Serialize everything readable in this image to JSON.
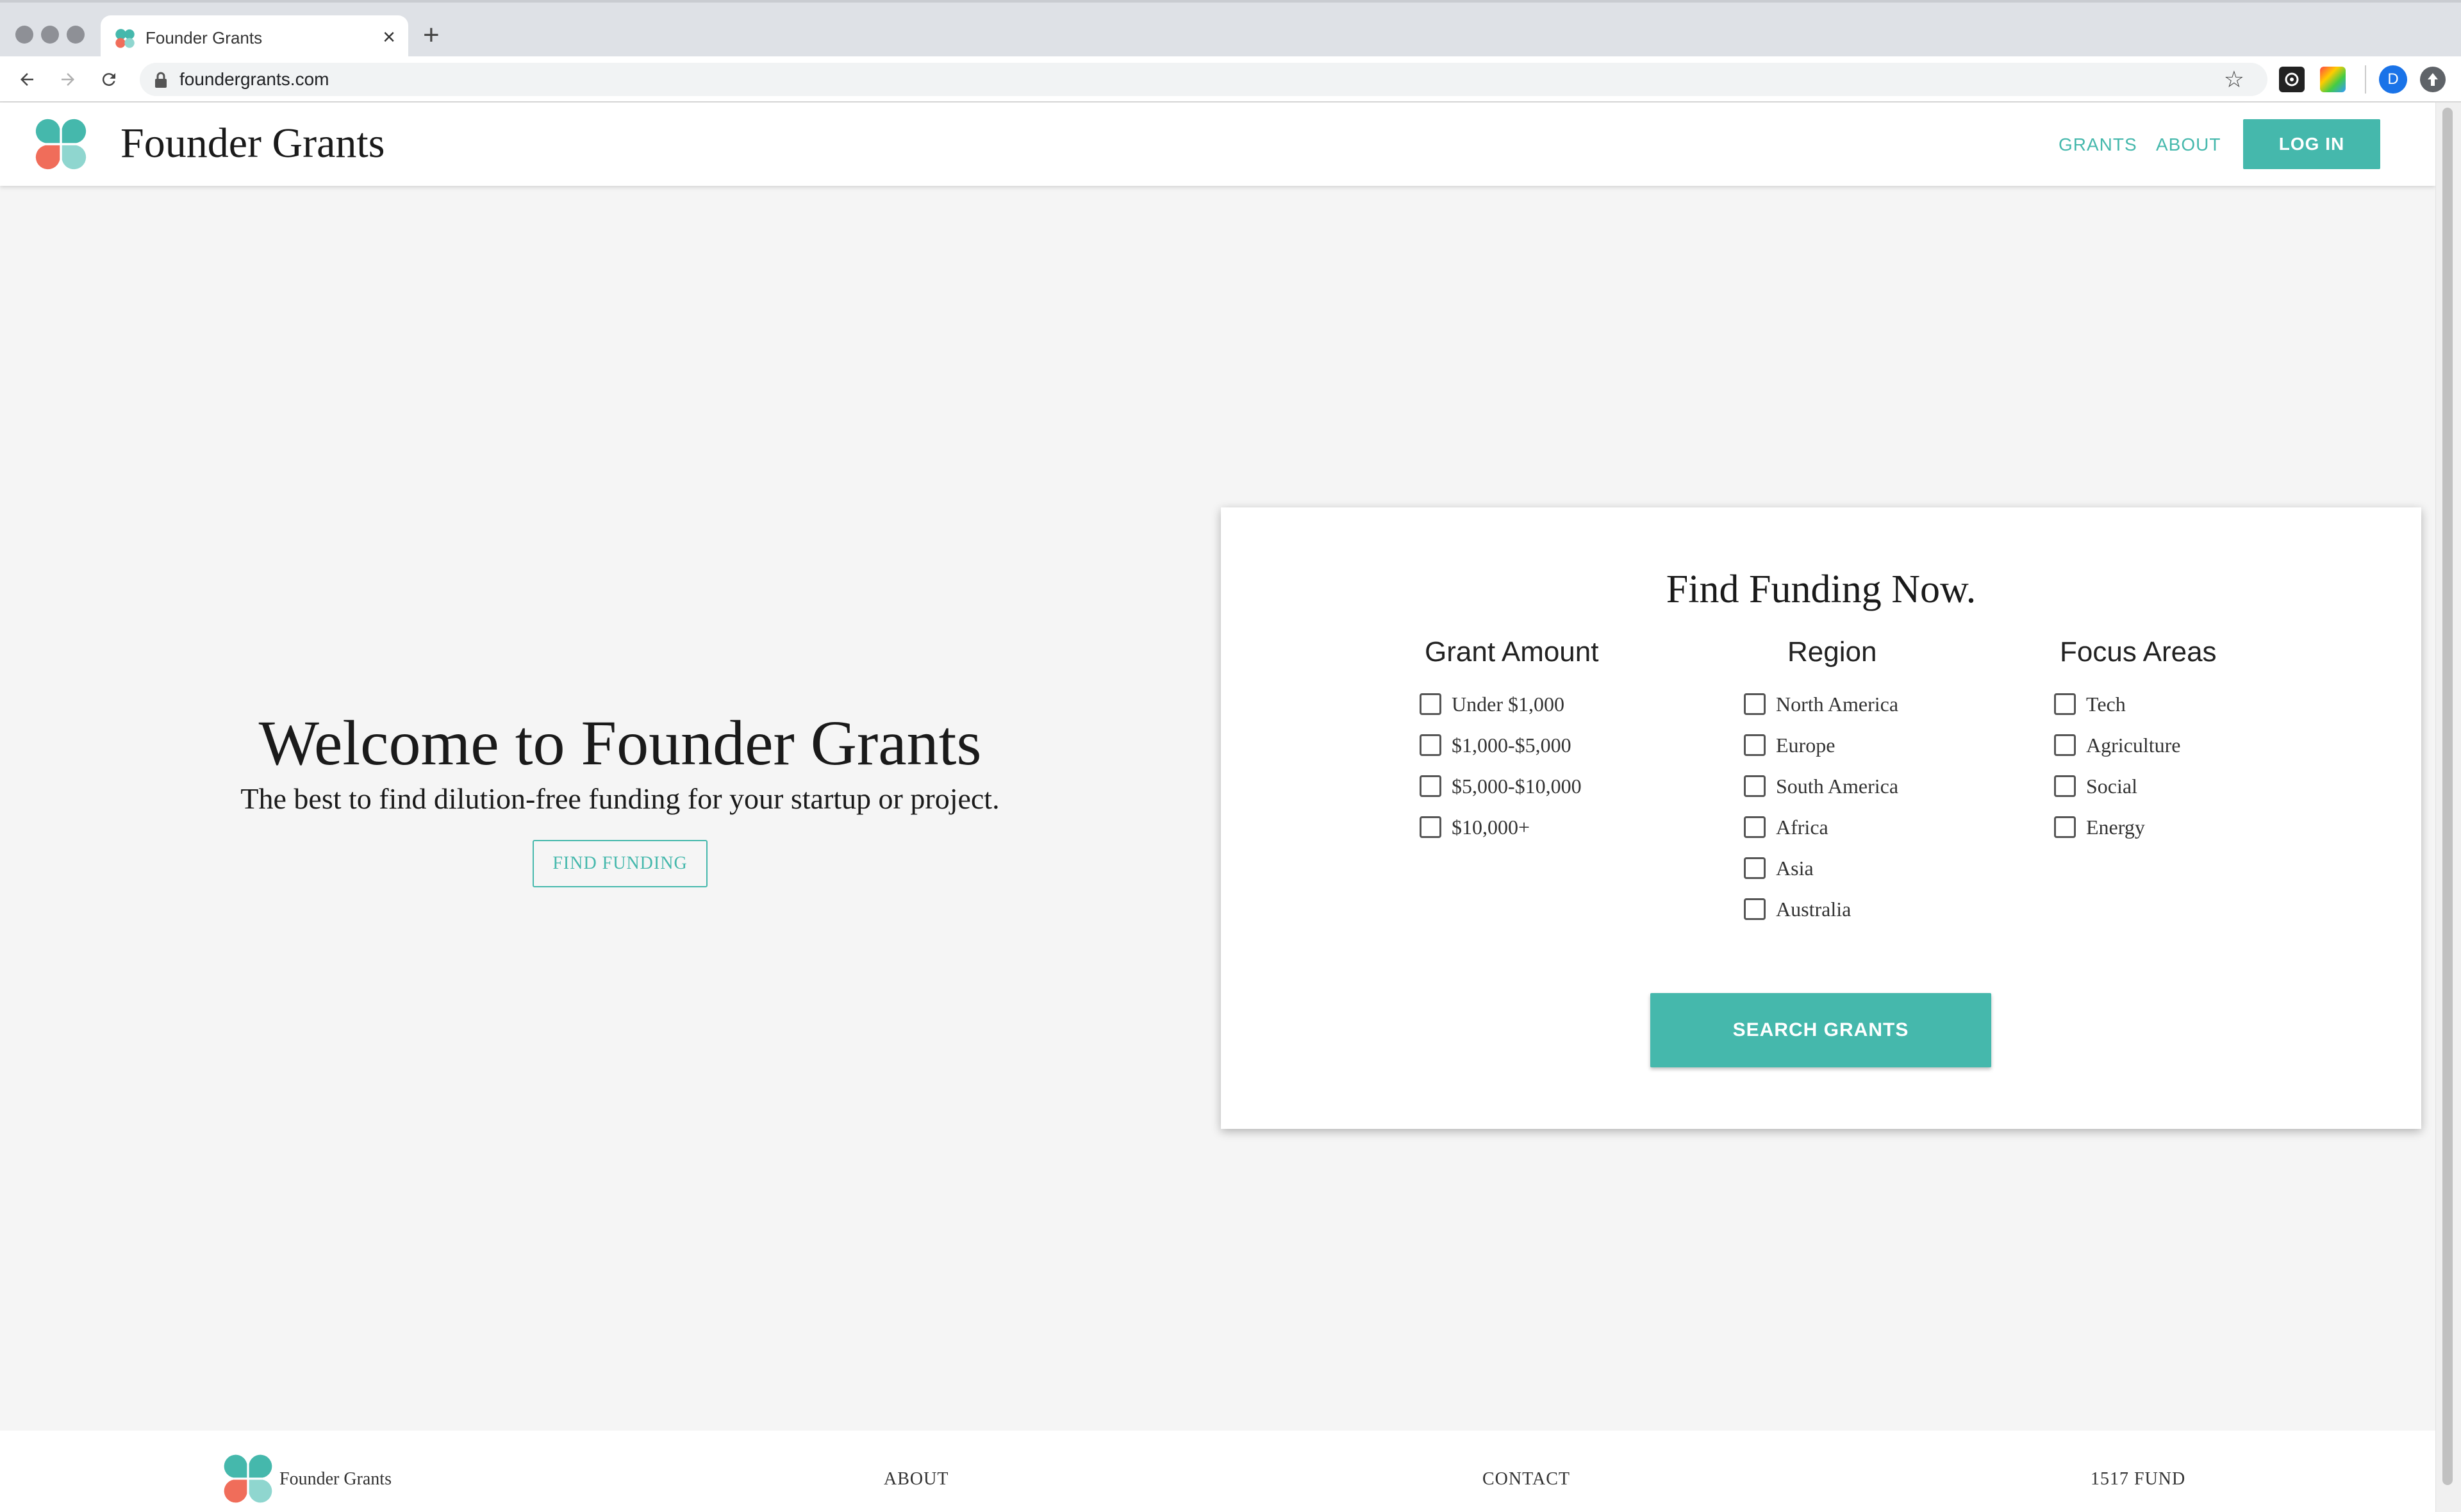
{
  "browser": {
    "tab_title": "Founder Grants",
    "tab_close": "×",
    "new_tab": "+",
    "url": "foundergrants.com",
    "bookmark_icon": "☆",
    "profile_initial": "D"
  },
  "header": {
    "brand": "Founder Grants",
    "nav": [
      "GRANTS",
      "ABOUT"
    ],
    "login_label": "LOG IN"
  },
  "hero": {
    "title": "Welcome to Founder Grants",
    "subtitle": "The best to find dilution-free funding for your startup or project.",
    "cta_label": "FIND FUNDING"
  },
  "search": {
    "title": "Find Funding Now.",
    "columns": [
      {
        "heading": "Grant Amount",
        "options": [
          "Under $1,000",
          "$1,000-$5,000",
          "$5,000-$10,000",
          "$10,000+"
        ]
      },
      {
        "heading": "Region",
        "options": [
          "North America",
          "Europe",
          "South America",
          "Africa",
          "Asia",
          "Australia"
        ]
      },
      {
        "heading": "Focus Areas",
        "options": [
          "Tech",
          "Agriculture",
          "Social",
          "Energy"
        ]
      }
    ],
    "button_label": "SEARCH GRANTS"
  },
  "footer": {
    "brand": "Founder Grants",
    "links": [
      "ABOUT",
      "CONTACT",
      "1517 FUND"
    ]
  },
  "colors": {
    "accent": "#45b8ac",
    "logo_teal": "#45b8ac",
    "logo_light_teal": "#8fd6cf",
    "logo_coral": "#f06d5a"
  }
}
